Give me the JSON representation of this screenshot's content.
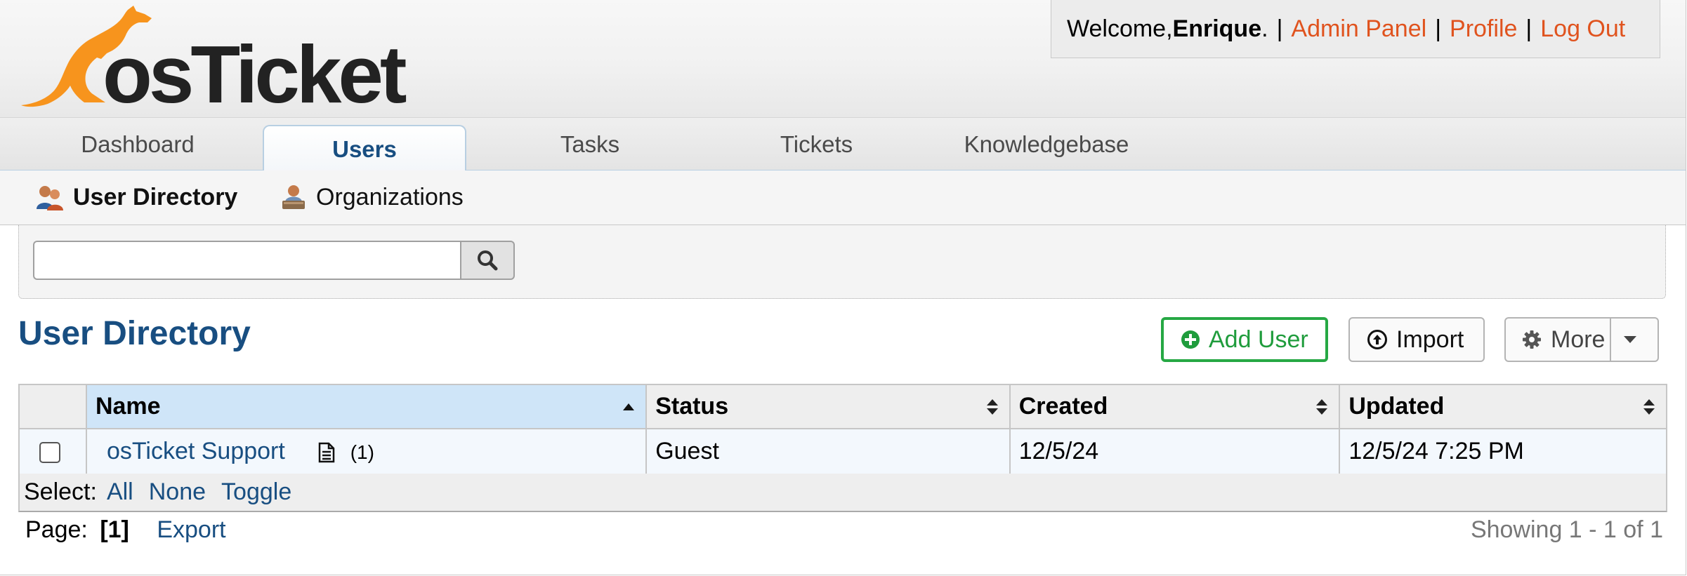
{
  "logo": {
    "text": "osTicket"
  },
  "header": {
    "welcome_prefix": "Welcome, ",
    "username": "Enrique",
    "welcome_suffix": ".",
    "links": [
      "Admin Panel",
      "Profile",
      "Log Out"
    ],
    "separator": "|"
  },
  "nav": {
    "tabs": [
      {
        "label": "Dashboard"
      },
      {
        "label": "Users",
        "active": true
      },
      {
        "label": "Tasks"
      },
      {
        "label": "Tickets"
      },
      {
        "label": "Knowledgebase"
      }
    ]
  },
  "subnav": {
    "items": [
      {
        "label": "User Directory",
        "icon": "users-icon",
        "active": true
      },
      {
        "label": "Organizations",
        "icon": "organization-icon"
      }
    ]
  },
  "search": {
    "value": "",
    "placeholder": "",
    "icon": "search-icon"
  },
  "page": {
    "title": "User Directory",
    "buttons": {
      "add_user": "Add User",
      "import": "Import",
      "more": "More"
    }
  },
  "table": {
    "columns": [
      "Name",
      "Status",
      "Created",
      "Updated"
    ],
    "sorted_column": "Name",
    "rows": [
      {
        "name": "osTicket Support",
        "ticket_count": "(1)",
        "status": "Guest",
        "created": "12/5/24",
        "updated": "12/5/24 7:25 PM"
      }
    ]
  },
  "select": {
    "label": "Select:",
    "options": [
      "All",
      "None",
      "Toggle"
    ]
  },
  "pagination": {
    "label": "Page:",
    "current": "[1]",
    "export": "Export",
    "showing": "Showing 1 - 1 of 1"
  },
  "colors": {
    "accent_blue": "#184e81",
    "link_orange": "#e0531e",
    "add_green": "#26a844",
    "logo_orange": "#f7941d"
  }
}
